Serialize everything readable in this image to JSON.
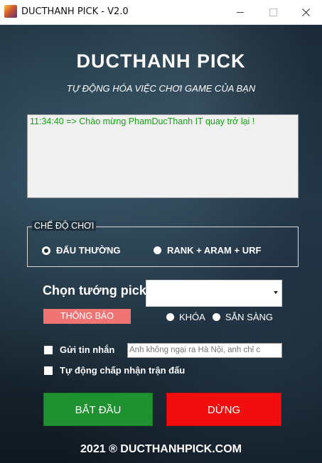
{
  "window": {
    "title": "DUCTHANH PICK - V2.0",
    "controls": {
      "minimize": "minimize",
      "maximize": "maximize",
      "close": "close"
    }
  },
  "header": {
    "title": "DUCTHANH PICK",
    "subtitle": "TỰ ĐỘNG HÓA VIỆC CHƠI GAME CỦA BẠN"
  },
  "log": {
    "lines": [
      "11:34:40 => Chào mừng PhamDucThanh IT quay trở lại !"
    ],
    "text_color": "#1a9e1a"
  },
  "game_mode": {
    "legend": "CHẾ ĐỘ CHƠI",
    "options": [
      {
        "label": "ĐẤU THƯỜNG",
        "selected": true
      },
      {
        "label": "RANK + ARAM + URF",
        "selected": false
      }
    ]
  },
  "champion": {
    "label": "Chọn tướng pick",
    "selected_value": "",
    "notice": "THÔNG BÁO",
    "lock_option": "KHÓA",
    "ready_option": "SẴN SÀNG"
  },
  "options": {
    "send_message_label": "Gửi tin nhắn",
    "send_message_checked": false,
    "message_value": "Anh không ngại ra Hà Nội, anh chỉ c",
    "auto_accept_label": "Tự động chấp nhận trận đấu",
    "auto_accept_checked": false
  },
  "buttons": {
    "start_label": "BẮT ĐẦU",
    "stop_label": "DỪNG",
    "start_color": "#1f9130",
    "stop_color": "#f20e0e"
  },
  "footer": {
    "text": "2021 ® DUCTHANHPICK.COM"
  },
  "colors": {
    "notice_bg": "#f07474",
    "background": "#1b2a36"
  }
}
